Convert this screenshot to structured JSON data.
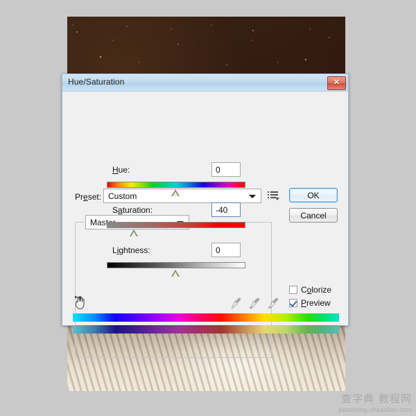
{
  "dialog": {
    "title": "Hue/Saturation",
    "close_icon": "close-icon",
    "close_glyph": "✕"
  },
  "preset": {
    "label": "Preset:",
    "label_prefix": "Pr",
    "label_accel": "e",
    "label_suffix": "set:",
    "value": "Custom",
    "menu_icon": "preset-options-icon"
  },
  "buttons": {
    "ok": "OK",
    "cancel": "Cancel"
  },
  "channel": {
    "value": "Master"
  },
  "sliders": [
    {
      "name": "hue",
      "label_prefix": "",
      "label_accel": "H",
      "label_suffix": "ue:",
      "label": "Hue:",
      "value": "0",
      "min": -180,
      "max": 180,
      "thumb_percent": 50,
      "focused": false,
      "track": "hue-rainbow"
    },
    {
      "name": "saturation",
      "label_prefix": "S",
      "label_accel": "a",
      "label_suffix": "turation:",
      "label": "Saturation:",
      "value": "-40",
      "min": -100,
      "max": 100,
      "thumb_percent": 30,
      "focused": true,
      "track": "gray-to-red"
    },
    {
      "name": "lightness",
      "label_prefix": "L",
      "label_accel": "i",
      "label_suffix": "ghtness:",
      "label": "Lightness:",
      "value": "0",
      "min": -100,
      "max": 100,
      "thumb_percent": 50,
      "focused": false,
      "track": "black-to-white"
    }
  ],
  "tools": {
    "hand_icon": "on-image-adjustment-hand-icon",
    "eyedropper_icon": "eyedropper-icon",
    "eyedropper_plus_icon": "eyedropper-plus-icon",
    "eyedropper_minus_icon": "eyedropper-minus-icon"
  },
  "checkboxes": {
    "colorize": {
      "label": "Colorize",
      "label_prefix": "C",
      "label_accel": "o",
      "label_suffix": "lorize",
      "checked": false
    },
    "preview": {
      "label": "Preview",
      "label_prefix": "",
      "label_accel": "P",
      "label_suffix": "review",
      "checked": true
    }
  },
  "spectrum": {
    "top_label": "source-hue-spectrum",
    "bottom_label": "result-hue-spectrum"
  },
  "watermark": {
    "cn": "查字典 教程网",
    "url": "jiaocheng.chazidian.com"
  },
  "colors": {
    "titlebar": "#c2dcf0",
    "dialog_bg": "#f0f0f0",
    "dialog_border": "#9bbcd4",
    "focus_blue": "#4b96d1",
    "close_red": "#cf4f3c",
    "check_blue": "#3a6ea5"
  }
}
